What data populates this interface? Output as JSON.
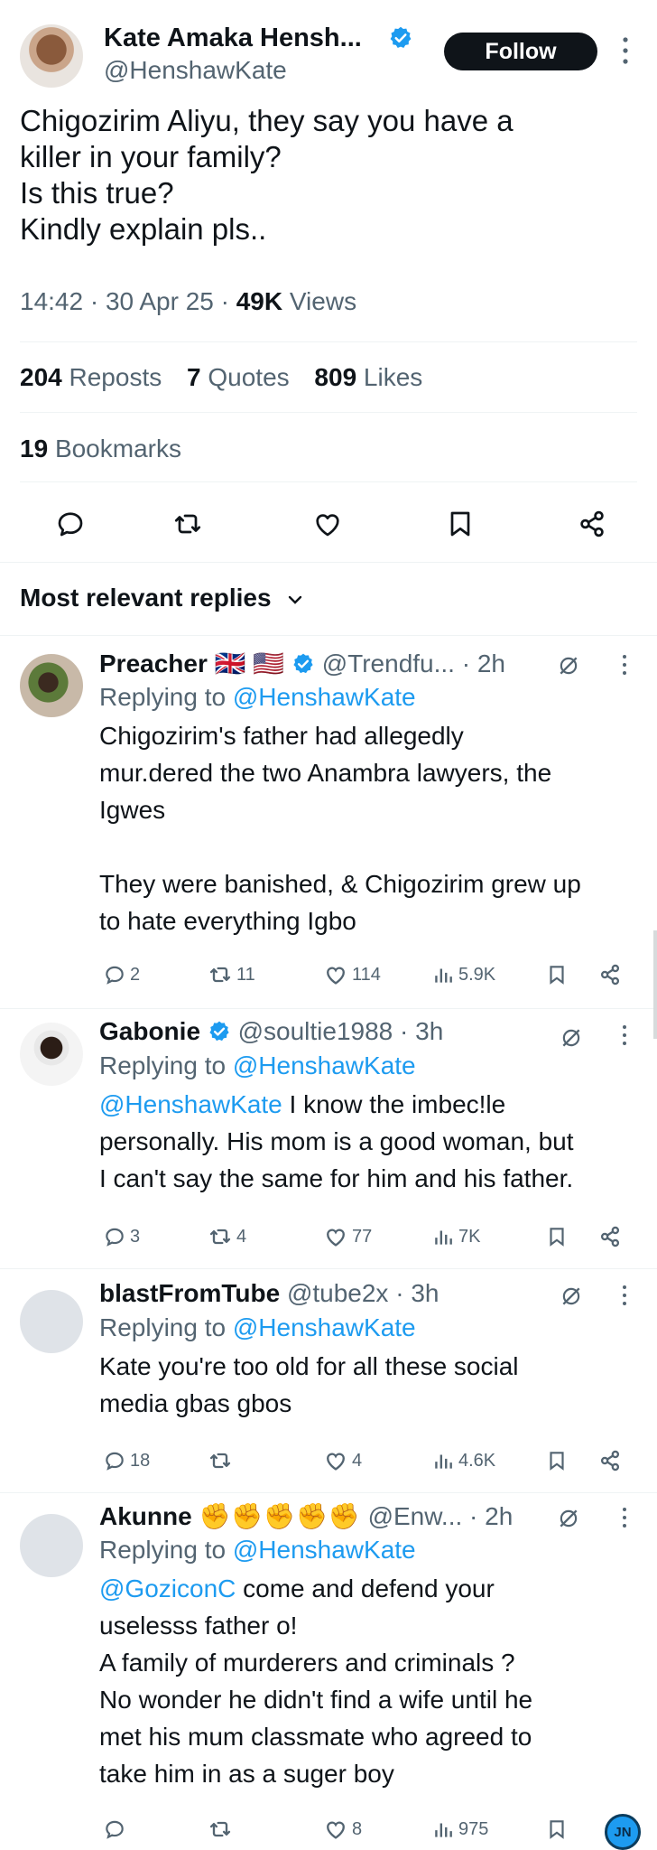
{
  "tweet": {
    "author_name": "Kate Amaka Hensh...",
    "author_handle": "@HenshawKate",
    "follow_label": "Follow",
    "text_lines": [
      "Chigozirim Aliyu, they say you have a",
      "killer in your family?",
      "Is this true?",
      "Kindly explain pls.."
    ],
    "time": "14:42",
    "date": "30 Apr 25",
    "views_count": "49K",
    "views_label": "Views",
    "reposts_count": "204",
    "reposts_label": "Reposts",
    "quotes_count": "7",
    "quotes_label": "Quotes",
    "likes_count": "809",
    "likes_label": "Likes",
    "bookmarks_count": "19",
    "bookmarks_label": "Bookmarks",
    "actions": [
      "reply-icon",
      "repost-icon",
      "like-icon",
      "bookmark-icon",
      "share-icon"
    ]
  },
  "replies_header": "Most relevant replies",
  "replies": [
    {
      "name": "Preacher",
      "emojis": "🇬🇧 🇺🇸",
      "verified": true,
      "handle": "@Trendfu...",
      "time": "· 2h",
      "replying_prefix": "Replying to",
      "replying_to": "@HenshawKate",
      "mention": "",
      "text_lines": [
        "Chigozirim's father had allegedly",
        "mur.dered the two Anambra lawyers, the",
        "Igwes",
        "",
        "They were banished, & Chigozirim grew up",
        "to hate everything Igbo"
      ],
      "replies": "2",
      "reposts": "11",
      "likes": "114",
      "views": "5.9K"
    },
    {
      "name": "Gabonie",
      "verified": true,
      "handle": "@soultie1988",
      "time": "· 3h",
      "replying_prefix": "Replying to",
      "replying_to": "@HenshawKate",
      "mention": "@HenshawKate",
      "text_lines": [
        " I know the imbec!le",
        "personally. His mom is a good woman, but",
        "I can't say the same for him and his father."
      ],
      "replies": "3",
      "reposts": "4",
      "likes": "77",
      "views": "7K"
    },
    {
      "name": "blastFromTube",
      "verified": false,
      "handle": "@tube2x",
      "time": "· 3h",
      "replying_prefix": "Replying to",
      "replying_to": "@HenshawKate",
      "mention": "",
      "text_lines": [
        "Kate you're too old for all these social",
        "media gbas gbos"
      ],
      "replies": "18",
      "reposts": "",
      "likes": "4",
      "views": "4.6K"
    },
    {
      "name": "Akunne",
      "emojis": "✊✊✊✊✊",
      "verified": false,
      "handle": "@Enw...",
      "time": "· 2h",
      "replying_prefix": "Replying to",
      "replying_to": "@HenshawKate",
      "mention": "@GoziconC",
      "text_lines": [
        " come and defend your",
        "uselesss father o!",
        "A family of murderers and criminals ?",
        "No wonder he didn't find a wife until he",
        "met his mum classmate who agreed to",
        "take him in as a suger boy"
      ],
      "replies": "",
      "reposts": "",
      "likes": "8",
      "views": "975"
    }
  ],
  "badge_text": "JN",
  "colors": {
    "link": "#1d9bf0",
    "text": "#0f1419",
    "muted": "#536471",
    "divider": "#eff3f4"
  }
}
